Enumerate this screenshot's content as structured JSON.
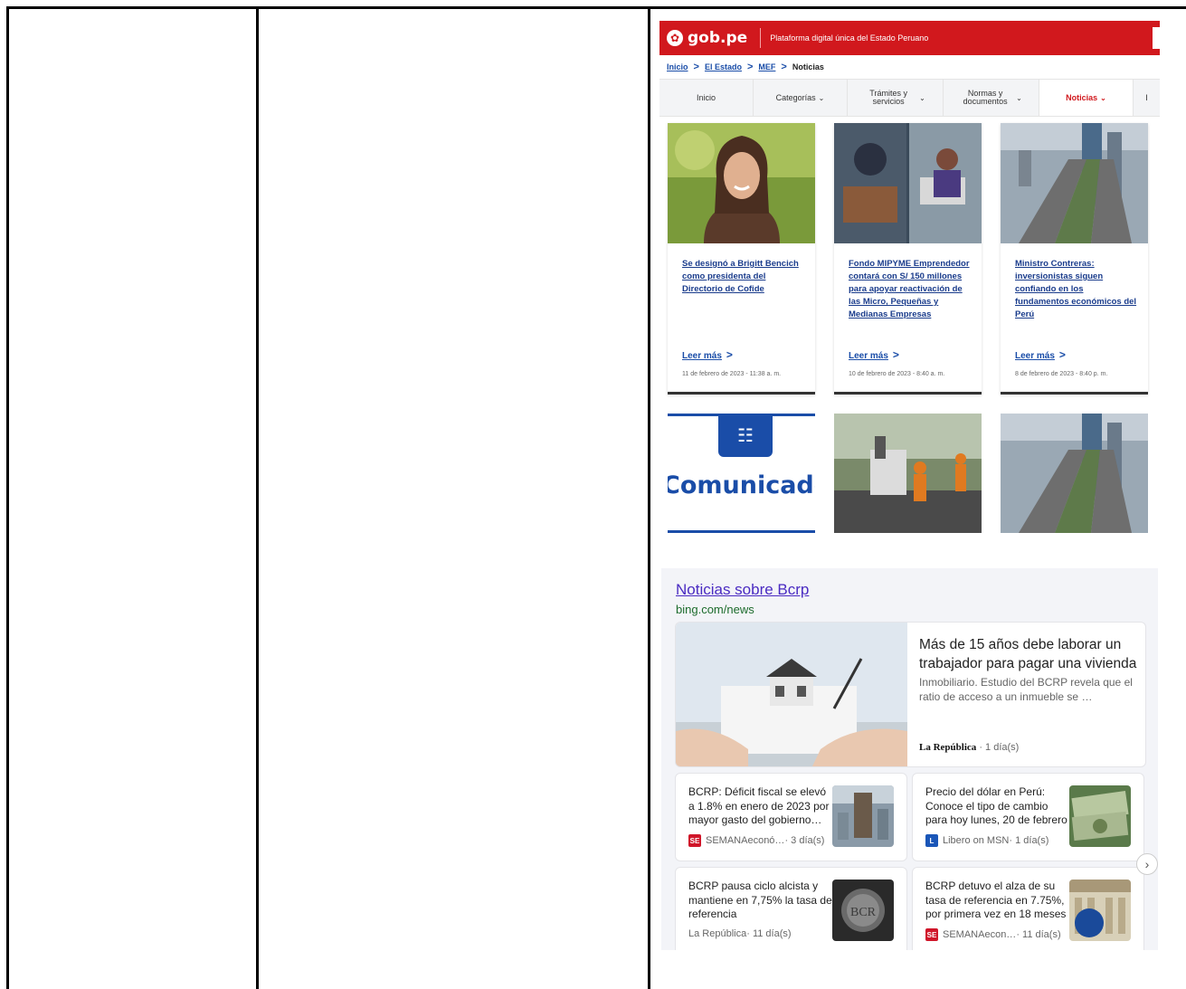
{
  "gob": {
    "logo_text": "gob.pe",
    "tagline": "Plataforma digital única del Estado Peruano",
    "breadcrumb": {
      "items": [
        "Inicio",
        "El Estado",
        "MEF"
      ],
      "current": "Noticias",
      "separator": ">"
    },
    "nav": {
      "items": [
        {
          "label": "Inicio"
        },
        {
          "label": "Categorías"
        },
        {
          "label": "Trámites y servicios"
        },
        {
          "label": "Normas y documentos"
        },
        {
          "label": "Noticias"
        },
        {
          "label": "I"
        }
      ]
    },
    "cards": [
      {
        "title": "Se designó a Brigitt Bencich como presidenta del Directorio de Cofide",
        "more": "Leer más",
        "date": "11 de febrero de 2023 - 11:38 a. m."
      },
      {
        "title": "Fondo MIPYME Emprendedor contará con S/ 150 millones para apoyar reactivación de las Micro, Pequeñas y Medianas Empresas",
        "more": "Leer más",
        "date": "10 de febrero de 2023 - 8:40 a. m."
      },
      {
        "title": "Ministro Contreras: inversionistas siguen confiando en los fundamentos económicos del Perú",
        "more": "Leer más",
        "date": "8 de febrero de 2023 - 8:40 p. m."
      }
    ],
    "comunicado_text": "Comunicado",
    "accent_color": "#d1181d"
  },
  "bing": {
    "title": "Noticias sobre Bcrp",
    "url": "bing.com/news",
    "featured": {
      "title": "Más de 15 años debe laborar un trabajador para pagar una vivienda",
      "snippet": "Inmobiliario. Estudio del BCRP revela que el ratio de acceso a un inmueble se …",
      "source": "La República",
      "age": "· 1 día(s)"
    },
    "items": [
      {
        "title": "BCRP: Déficit fiscal se elevó a 1.8% en enero de 2023 por mayor gasto del gobierno…",
        "badge": "SE",
        "source": "SEMANAeconó…",
        "age": " · 3 día(s)"
      },
      {
        "title": "Precio del dólar en Perú: Conoce el tipo de cambio para hoy lunes, 20 de febrero",
        "badge": "L",
        "source": "Libero on MSN",
        "age": " · 1 día(s)"
      },
      {
        "title": "BCRP pausa ciclo alcista y mantiene en 7,75% la tasa de referencia",
        "badge": "",
        "source": "La República",
        "age": " · 11 día(s)"
      },
      {
        "title": "BCRP detuvo el alza de su tasa de referencia en 7.75%, por primera vez en 18 meses",
        "badge": "SE",
        "source": "SEMANAecon…",
        "age": " · 11 día(s)"
      }
    ],
    "link_color": "#4a2bc2",
    "url_color": "#1c6b2c"
  },
  "icons": {
    "chevron": "⌄",
    "arrow": ">",
    "next": "›"
  }
}
